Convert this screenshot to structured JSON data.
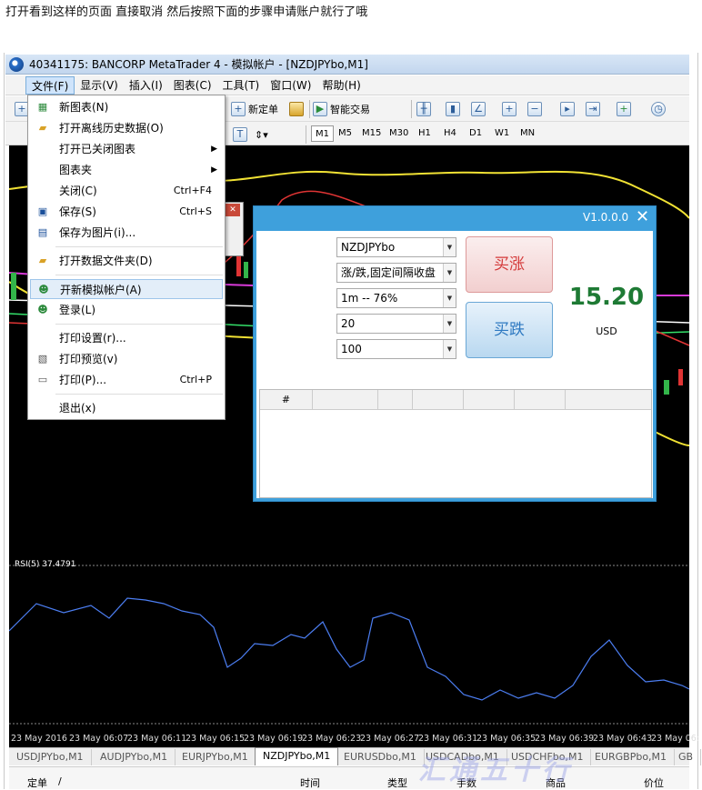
{
  "caption": "打开看到这样的页面 直接取消 然后按照下面的步骤申请账户就行了哦",
  "window": {
    "title": "40341175: BANCORP MetaTrader 4 - 模拟帐户 - [NZDJPYbo,M1]"
  },
  "menu": [
    "文件(F)",
    "显示(V)",
    "插入(I)",
    "图表(C)",
    "工具(T)",
    "窗口(W)",
    "帮助(H)"
  ],
  "toolbar": {
    "new_order": "新定单",
    "smart_trade": "智能交易"
  },
  "timeframes": [
    "M1",
    "M5",
    "M15",
    "M30",
    "H1",
    "H4",
    "D1",
    "W1",
    "MN"
  ],
  "file_menu": [
    {
      "label": "新图表(N)",
      "shortcut": "",
      "icon": "new-chart-icon"
    },
    {
      "label": "打开离线历史数据(O)",
      "shortcut": "",
      "icon": "folder-open-icon"
    },
    {
      "label": "打开已关闭图表",
      "shortcut": "",
      "icon": "",
      "sub": true
    },
    {
      "label": "图表夹",
      "shortcut": "",
      "icon": "",
      "sub": true
    },
    {
      "label": "关闭(C)",
      "shortcut": "Ctrl+F4",
      "icon": ""
    },
    {
      "label": "保存(S)",
      "shortcut": "Ctrl+S",
      "icon": "save-icon"
    },
    {
      "label": "保存为图片(i)...",
      "shortcut": "",
      "icon": "save-image-icon"
    },
    {
      "label": "打开数据文件夹(D)",
      "shortcut": "",
      "icon": "data-folder-icon"
    },
    {
      "label": "开新模拟帐户(A)",
      "shortcut": "",
      "icon": "new-demo-account-icon"
    },
    {
      "label": "登录(L)",
      "shortcut": "",
      "icon": "login-icon"
    },
    {
      "label": "打印设置(r)...",
      "shortcut": "",
      "icon": ""
    },
    {
      "label": "打印预览(v)",
      "shortcut": "",
      "icon": "print-preview-icon"
    },
    {
      "label": "打印(P)...",
      "shortcut": "Ctrl+P",
      "icon": "print-icon"
    },
    {
      "label": "退出(x)",
      "shortcut": "",
      "icon": ""
    }
  ],
  "panel": {
    "version": "V1.0.0.0",
    "close": "✕",
    "symbol": "NZDJPYbo",
    "mode": "涨/跌,固定间隔收盘",
    "expiry": "1m -- 76%",
    "amount_select": "20",
    "quantity": "100",
    "buy_up": "买涨",
    "buy_down": "买跌",
    "balance": "15.20",
    "currency": "USD",
    "grid_header": "#"
  },
  "rsi_label": "RSI(5) 37.4791",
  "time_labels": [
    "23 May 2016",
    "23 May 06:07",
    "23 May 06:11",
    "23 May 06:15",
    "23 May 06:19",
    "23 May 06:23",
    "23 May 06:27",
    "23 May 06:31",
    "23 May 06:35",
    "23 May 06:39",
    "23 May 06:43",
    "23 May 06:"
  ],
  "tabs": [
    "USDJPYbo,M1",
    "AUDJPYbo,M1",
    "EURJPYbo,M1",
    "NZDJPYbo,M1",
    "EURUSDbo,M1",
    "USDCADbo,M1",
    "USDCHFbo,M1",
    "EURGBPbo,M1",
    "GB"
  ],
  "bottom_cols": [
    "定单",
    "/",
    "时间",
    "类型",
    "手数",
    "商品",
    "价位"
  ],
  "watermark": "汇通五十行",
  "colors": {
    "panel_blue": "#3ea0dc",
    "balance_green": "#1e7a34",
    "buy_up_red": "#d43a3a",
    "chart_bg": "#000000",
    "rsi_line": "#4c7ef2"
  }
}
